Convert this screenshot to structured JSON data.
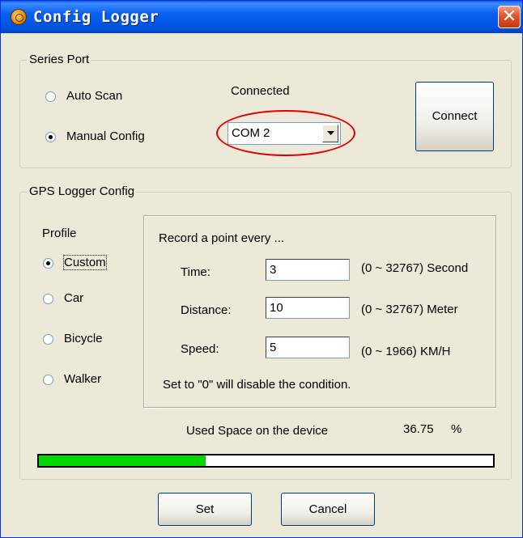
{
  "window": {
    "title": "Config Logger",
    "close_symbol": "✕"
  },
  "series_port": {
    "legend": "Series Port",
    "auto_scan_label": "Auto Scan",
    "auto_scan_checked": false,
    "manual_config_label": "Manual Config",
    "manual_config_checked": true,
    "status": "Connected",
    "port_selected": "COM 2",
    "connect_label": "Connect"
  },
  "gps_config": {
    "legend": "GPS Logger Config",
    "profile_label": "Profile",
    "profiles": [
      {
        "label": "Custom",
        "checked": true
      },
      {
        "label": "Car",
        "checked": false
      },
      {
        "label": "Bicycle",
        "checked": false
      },
      {
        "label": "Walker",
        "checked": false
      }
    ],
    "record_heading": "Record a point every ...",
    "fields": [
      {
        "label": "Time:",
        "value": "3",
        "range": "(0 ~ 32767) Second"
      },
      {
        "label": "Distance:",
        "value": "10",
        "range": "(0 ~ 32767) Meter"
      },
      {
        "label": "Speed:",
        "value": "5",
        "range": "(0 ~ 1966) KM/H"
      }
    ],
    "note": "Set to \"0\" will disable the condition.",
    "used_space_label": "Used Space on the  device",
    "used_space_value": "36.75",
    "used_space_unit": "%",
    "used_space_fraction": 0.3675
  },
  "buttons": {
    "set_label": "Set",
    "cancel_label": "Cancel"
  },
  "colors": {
    "title_bar": "#0A5FEF",
    "highlight": "#E00000",
    "progress": "#00D800",
    "close": "#E0552E"
  }
}
